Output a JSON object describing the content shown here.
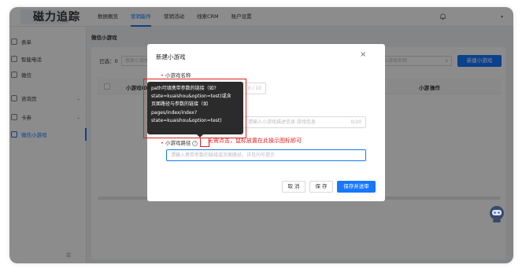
{
  "app": {
    "logo": "磁力追踪"
  },
  "nav": {
    "items": [
      "数据概览",
      "营销能件",
      "营销活动",
      "线索CRM",
      "账户设置"
    ],
    "active_index": 1
  },
  "sidebar": {
    "items": [
      {
        "label": "表单",
        "icon": "form-icon"
      },
      {
        "label": "智能电话",
        "icon": "phone-icon"
      },
      {
        "label": "微信",
        "icon": "wechat-icon"
      },
      {
        "label": "咨询页",
        "icon": "chat-icon",
        "has_children": true
      },
      {
        "label": "卡券",
        "icon": "coupon-icon",
        "has_children": true
      },
      {
        "label": "微信小游戏",
        "icon": "game-icon",
        "active": true
      }
    ],
    "collapse_symbol": "☰"
  },
  "page": {
    "title": "微信小游戏",
    "selected_label": "已选：0",
    "filter_placeholder": "搜索小游戏",
    "search_placeholder": "小游戏名称",
    "new_button": "新建小游戏",
    "columns": [
      "小游戏ID",
      "小游",
      "操作"
    ]
  },
  "modal": {
    "title": "新建小游戏",
    "name_label": "小游戏名称",
    "name_counter": "0 / 10",
    "desc_placeholder": "请输入小游戏描述信息·游戏信息",
    "desc_counter": "0/20",
    "path_label": "小游戏路径",
    "path_placeholder": "请输入携带参数的链接或页面路径，详见问号提示",
    "annotation": "无需点击，鼠标放置在此操示图标即可",
    "buttons": {
      "cancel": "取 消",
      "save": "保 存",
      "save_submit": "保存并送审"
    }
  },
  "tooltip": {
    "lines": [
      "path可填携带参数的链接（如?",
      "state=kuaishou&option=test)或含",
      "页面路径与参数的链接（如",
      "pages/index/index?",
      "state=kuaishou&option=test)"
    ]
  },
  "colors": {
    "primary": "#1677ff",
    "highlight": "#e02020"
  }
}
